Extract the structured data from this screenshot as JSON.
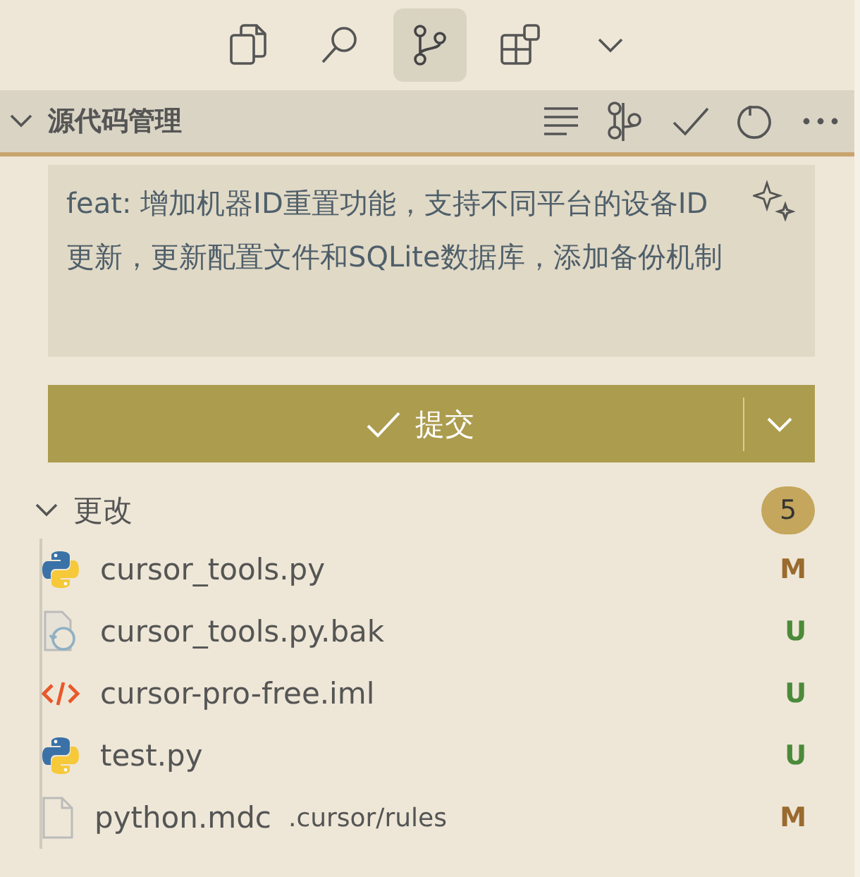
{
  "activity_bar": [
    {
      "kind": "files",
      "selected": false
    },
    {
      "kind": "search",
      "selected": false
    },
    {
      "kind": "source-control",
      "selected": true
    },
    {
      "kind": "extensions",
      "selected": false
    },
    {
      "kind": "chevron",
      "selected": false
    }
  ],
  "section": {
    "title": "源代码管理",
    "expanded": true,
    "actions": [
      {
        "kind": "list"
      },
      {
        "kind": "graph"
      },
      {
        "kind": "check"
      },
      {
        "kind": "refresh"
      },
      {
        "kind": "more"
      }
    ]
  },
  "commit_message": {
    "value": "feat: 增加机器ID重置功能，支持不同平台的设备ID更新，更新配置文件和SQLite数据库，添加备份机制"
  },
  "commit_button": {
    "label": "提交"
  },
  "changes": {
    "title": "更改",
    "expanded": true,
    "count": "5",
    "files": [
      {
        "name": "cursor_tools.py",
        "kind": "python",
        "status": "M"
      },
      {
        "name": "cursor_tools.py.bak",
        "kind": "backup",
        "status": "U"
      },
      {
        "name": "cursor-pro-free.iml",
        "kind": "code",
        "status": "U"
      },
      {
        "name": "test.py",
        "kind": "python",
        "status": "U"
      },
      {
        "name": "python.mdc",
        "path": ".cursor/rules",
        "kind": "file",
        "status": "M"
      }
    ]
  }
}
